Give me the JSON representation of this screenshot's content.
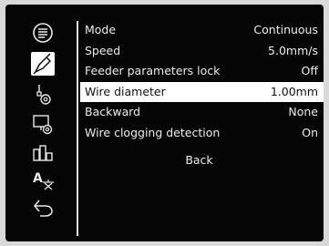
{
  "sidebar": {
    "icons": [
      {
        "name": "list-icon"
      },
      {
        "name": "wire-feeder-icon",
        "active": true
      },
      {
        "name": "torch-settings-icon"
      },
      {
        "name": "display-settings-icon"
      },
      {
        "name": "bar-layout-icon"
      },
      {
        "name": "language-icon",
        "text": "A"
      },
      {
        "name": "return-icon"
      }
    ]
  },
  "menu": {
    "rows": [
      {
        "label": "Mode",
        "value": "Continuous"
      },
      {
        "label": "Speed",
        "value": "5.0mm/s"
      },
      {
        "label": "Feeder parameters lock",
        "value": "Off"
      },
      {
        "label": "Wire diameter",
        "value": "1.00mm",
        "selected": true
      },
      {
        "label": "Backward",
        "value": "None"
      },
      {
        "label": "Wire clogging detection",
        "value": "On"
      }
    ],
    "back_label": "Back"
  },
  "colors": {
    "background": "#050505",
    "foreground": "#ececec",
    "highlight": "#ffffff"
  }
}
